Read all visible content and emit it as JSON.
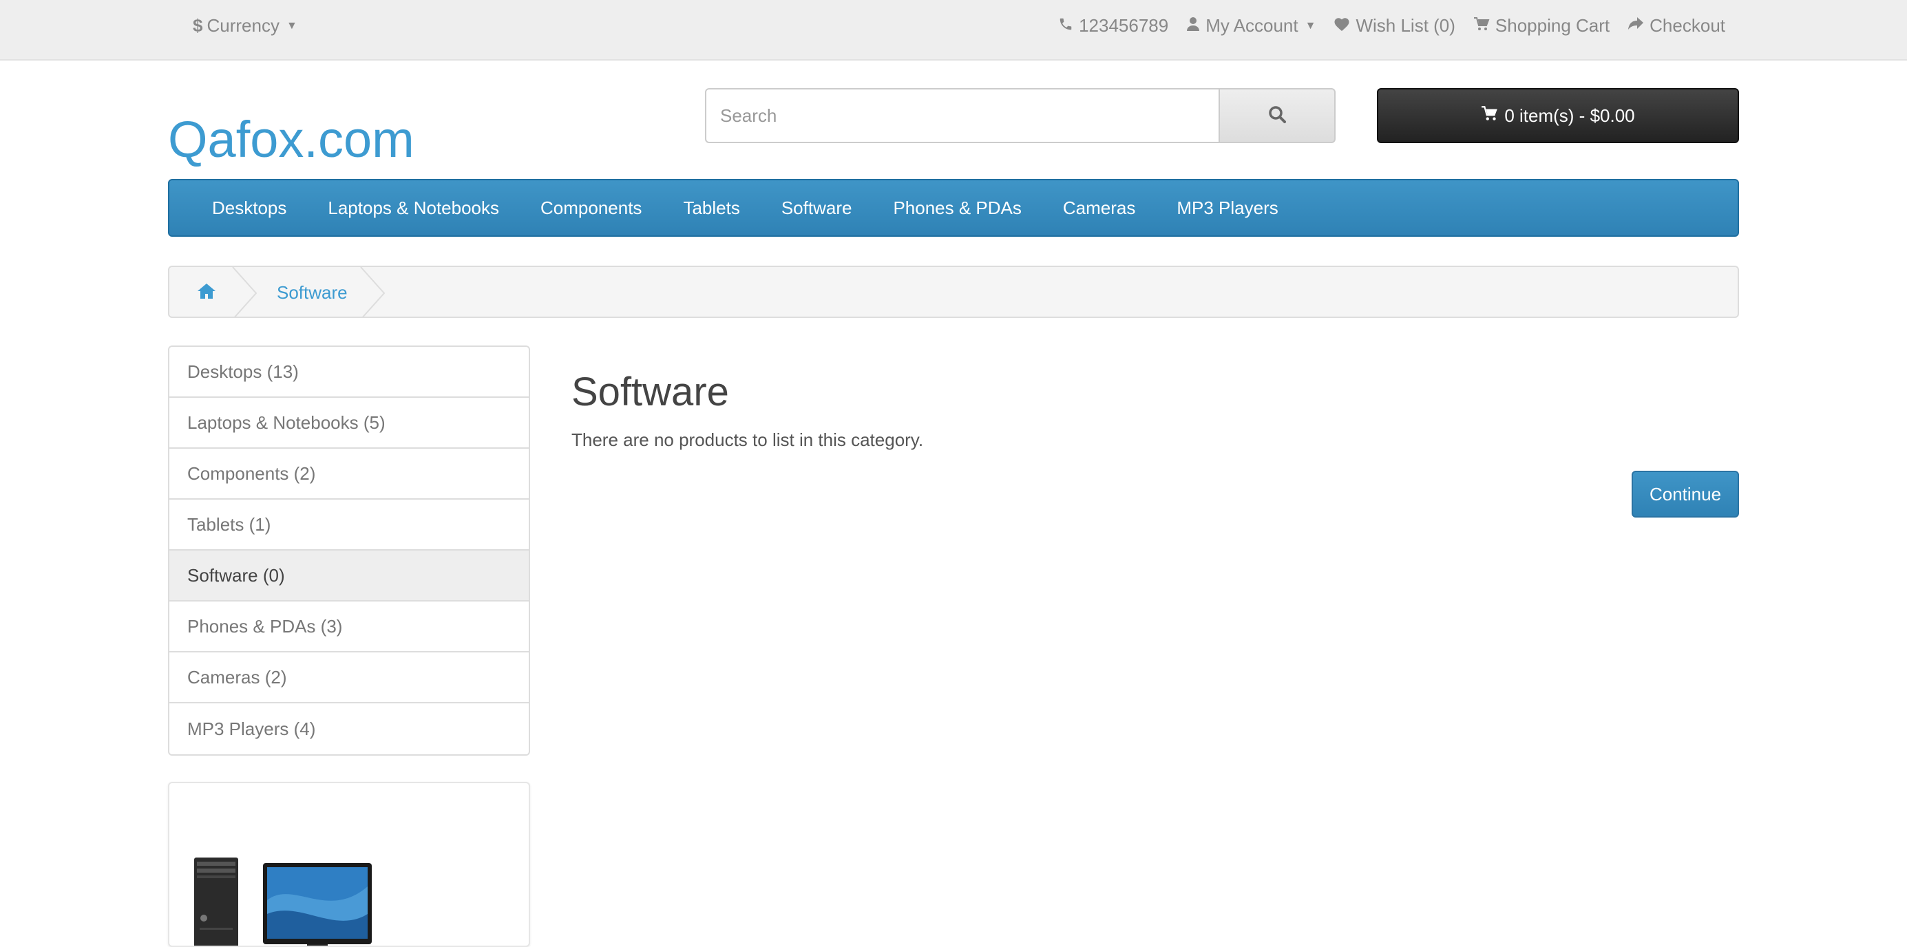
{
  "topbar": {
    "currency_label": "Currency",
    "phone": "123456789",
    "my_account": "My Account",
    "wish_list": "Wish List (0)",
    "shopping_cart": "Shopping Cart",
    "checkout": "Checkout"
  },
  "header": {
    "logo": "Qafox.com",
    "search_placeholder": "Search",
    "cart_summary": "0 item(s) - $0.00"
  },
  "menu": {
    "items": [
      {
        "label": "Desktops"
      },
      {
        "label": "Laptops & Notebooks"
      },
      {
        "label": "Components"
      },
      {
        "label": "Tablets"
      },
      {
        "label": "Software"
      },
      {
        "label": "Phones & PDAs"
      },
      {
        "label": "Cameras"
      },
      {
        "label": "MP3 Players"
      }
    ]
  },
  "breadcrumb": {
    "current": "Software"
  },
  "sidebar": {
    "items": [
      {
        "label": "Desktops (13)"
      },
      {
        "label": "Laptops & Notebooks (5)"
      },
      {
        "label": "Components (2)"
      },
      {
        "label": "Tablets (1)"
      },
      {
        "label": "Software (0)",
        "active": true
      },
      {
        "label": "Phones & PDAs (3)"
      },
      {
        "label": "Cameras (2)"
      },
      {
        "label": "MP3 Players (4)"
      }
    ]
  },
  "main": {
    "title": "Software",
    "empty_message": "There are no products to list in this category.",
    "continue_label": "Continue"
  },
  "colors": {
    "brand_blue": "#3d9bd1",
    "menu_blue": "#2f82b5",
    "cart_dark": "#222222"
  }
}
